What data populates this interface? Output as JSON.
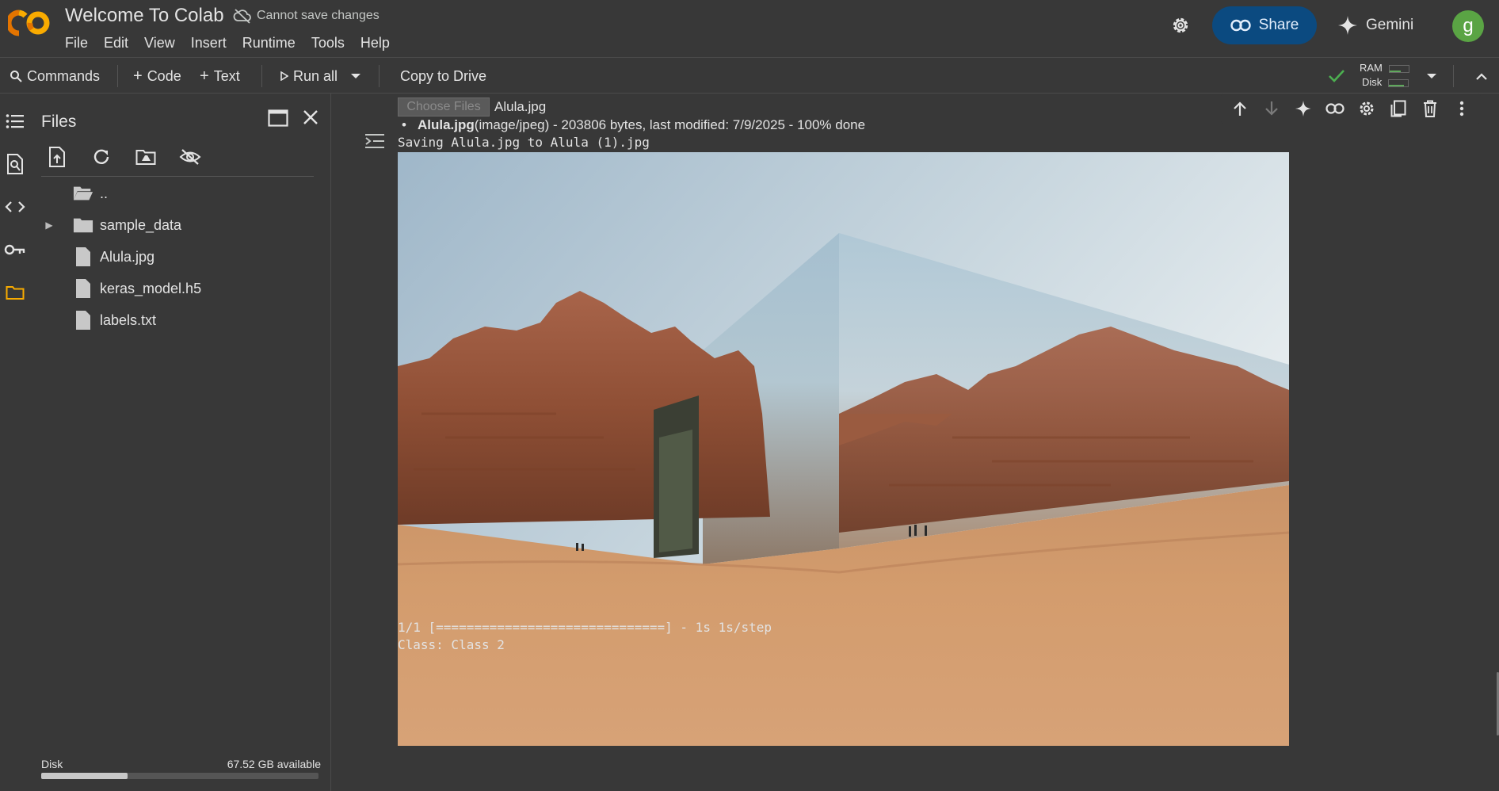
{
  "header": {
    "title": "Welcome To Colab",
    "save_status": "Cannot save changes",
    "menu": [
      "File",
      "Edit",
      "View",
      "Insert",
      "Runtime",
      "Tools",
      "Help"
    ],
    "share_label": "Share",
    "gemini_label": "Gemini",
    "avatar_letter": "g"
  },
  "toolbar": {
    "commands_label": "Commands",
    "code_label": "Code",
    "text_label": "Text",
    "run_all_label": "Run all",
    "copy_to_drive_label": "Copy to Drive",
    "ram_label": "RAM",
    "disk_label": "Disk"
  },
  "files_panel": {
    "title": "Files",
    "items": [
      {
        "name": "..",
        "type": "parent-folder"
      },
      {
        "name": "sample_data",
        "type": "folder"
      },
      {
        "name": "Alula.jpg",
        "type": "file"
      },
      {
        "name": "keras_model.h5",
        "type": "file"
      },
      {
        "name": "labels.txt",
        "type": "file"
      }
    ],
    "disk_label": "Disk",
    "disk_available": "67.52 GB available",
    "disk_used_fraction": 0.31
  },
  "output": {
    "choose_files_label": "Choose Files",
    "chosen_file": "Alula.jpg",
    "upload_filename": "Alula.jpg",
    "upload_details": "(image/jpeg) - 203806 bytes, last modified: 7/9/2025 - 100% done",
    "saving_line": "Saving Alula.jpg to Alula (1).jpg",
    "progress_line": "1/1 [==============================] - 1s 1s/step",
    "class_line": "Class: Class 2"
  },
  "colors": {
    "background": "#383838",
    "share_button": "#0b4a80",
    "logo_orange": "#f9ab00",
    "logo_dark_orange": "#e37400",
    "avatar": "#5aa444",
    "ok_check": "#4caf50",
    "folder_active": "#f9ab00"
  },
  "icons": [
    "colab-logo",
    "cloud-off-icon",
    "gear-icon",
    "link-icon",
    "gemini-spark-icon",
    "search-icon",
    "plus-icon",
    "play-icon",
    "chevron-down-icon",
    "check-icon",
    "chevron-up-icon",
    "toc-icon",
    "find-icon",
    "code-icon",
    "key-icon",
    "folder-icon",
    "window-icon",
    "close-icon",
    "upload-icon",
    "refresh-icon",
    "drive-folder-icon",
    "visibility-off-icon",
    "file-icon",
    "arrow-up-icon",
    "arrow-down-icon",
    "sparkle-icon",
    "settings-icon",
    "mirror-icon",
    "delete-icon",
    "more-vert-icon",
    "output-collapse-icon"
  ]
}
